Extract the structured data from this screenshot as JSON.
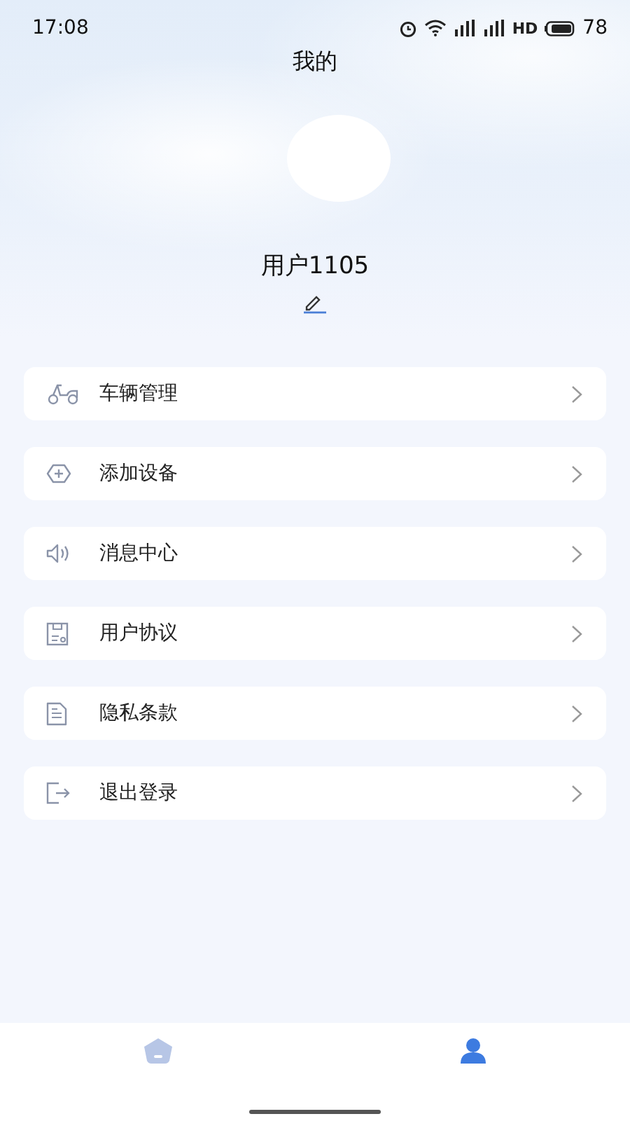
{
  "status_bar": {
    "time": "17:08",
    "hd": "HD",
    "battery": "78"
  },
  "title": "我的",
  "profile": {
    "username": "用户1105"
  },
  "menu": [
    {
      "kind": "vehicle",
      "label": "车辆管理"
    },
    {
      "kind": "add",
      "label": "添加设备"
    },
    {
      "kind": "message",
      "label": "消息中心"
    },
    {
      "kind": "agreement",
      "label": "用户协议"
    },
    {
      "kind": "privacy",
      "label": "隐私条款"
    },
    {
      "kind": "logout",
      "label": "退出登录"
    }
  ],
  "tab_bar": [
    {
      "kind": "home",
      "selected": false
    },
    {
      "kind": "profile",
      "selected": true
    }
  ]
}
